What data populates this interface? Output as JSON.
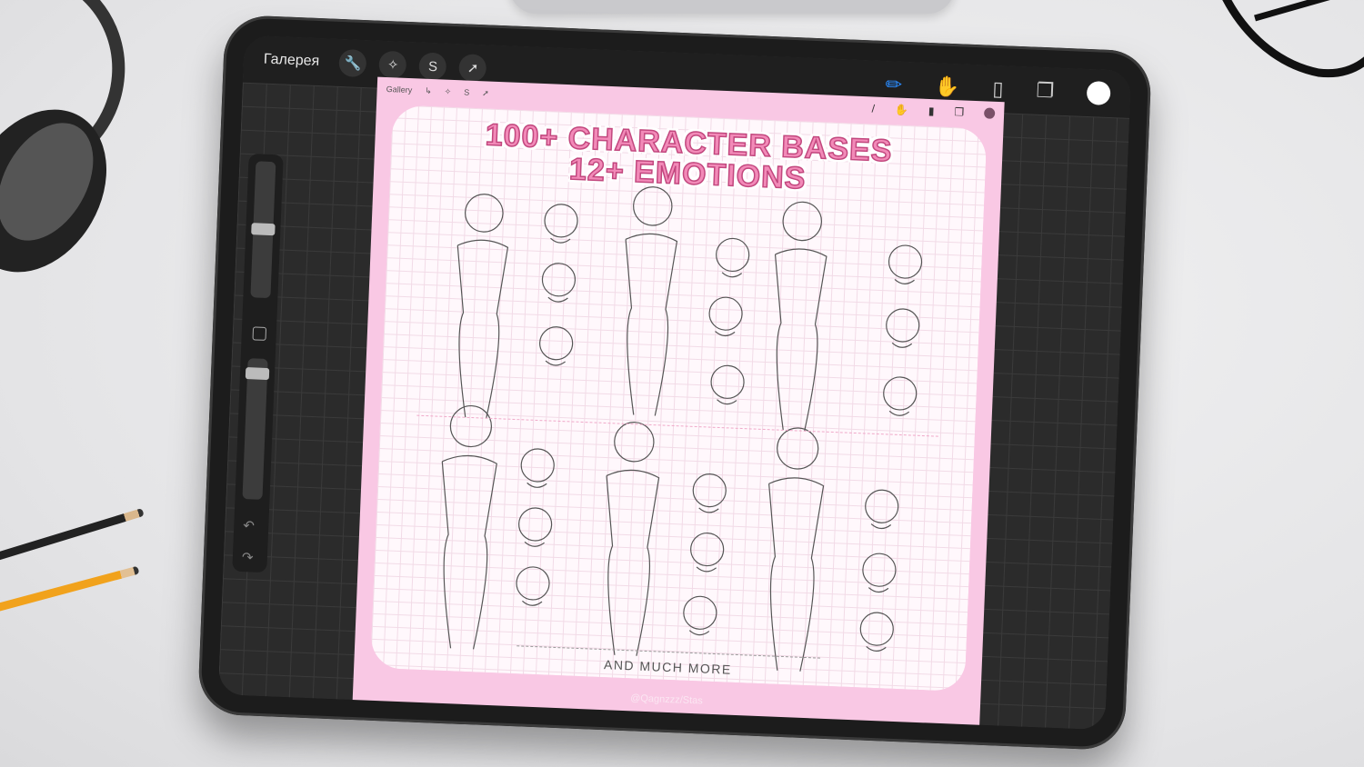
{
  "app": {
    "gallery_label": "Галерея"
  },
  "toolbar": {
    "left_icons": [
      "wrench-icon",
      "magic-wand-icon",
      "selection-icon",
      "transform-arrow-icon"
    ],
    "right_icons": [
      "brush-icon",
      "smudge-icon",
      "eraser-icon",
      "layers-icon",
      "color-icon"
    ]
  },
  "inner_canvas": {
    "gallery_label": "Gallery",
    "title_line1": "100+ CHARACTER BASES",
    "title_line2": "12+ EMOTIONS",
    "footer": "AND MUCH MORE",
    "watermark": "@Qagnzzz/Stas"
  },
  "colors": {
    "accent_brush": "#2a8cff",
    "canvas_pink": "#f9c8e4",
    "title_pink": "#f28ab8"
  }
}
